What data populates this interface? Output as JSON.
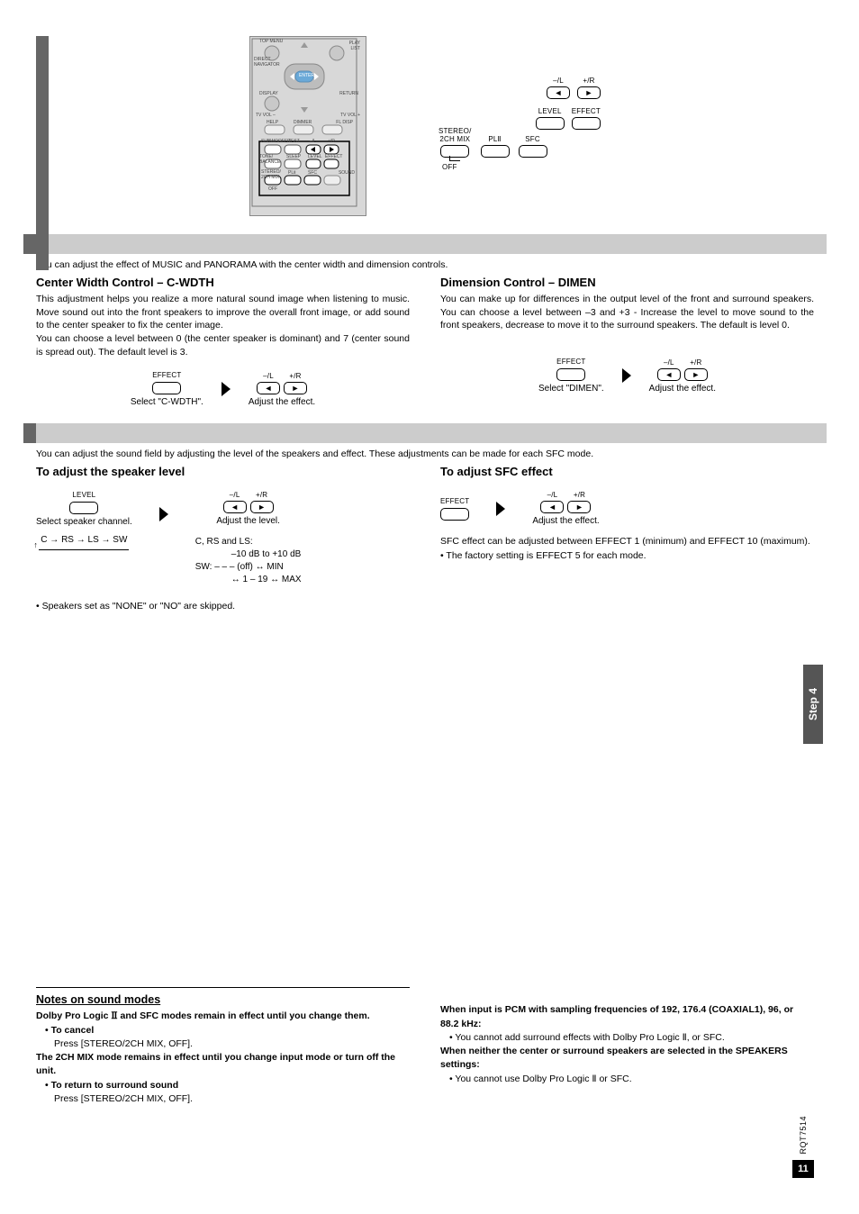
{
  "remote": {
    "labels": {
      "top_menu": "TOP MENU",
      "direct_navigator": "DIRECT NAVIGATOR",
      "play_list": "PLAY LIST",
      "enter": "ENTER",
      "display": "DISPLAY",
      "return": "RETURN",
      "tv_vol_minus": "TV VOL –",
      "tv_vol_plus": "TV VOL +",
      "help": "HELP",
      "dimmer": "DIMMER",
      "fl_disp": "FL DISP",
      "sleep2": "SLEEP",
      "subwoofer": "SUBWOOFER",
      "test": "TEST",
      "tone_balance": "TONE/ BALANCE",
      "sleep": "SLEEP",
      "minus_l": "–/L",
      "plus_r": "+/R",
      "level": "LEVEL",
      "effect": "EFFECT",
      "stereo_2ch": "STEREO/ 2CH MIX",
      "dpl2": "PLⅡ",
      "sfc": "SFC",
      "sound": "SOUND",
      "off": "OFF"
    }
  },
  "right_cluster": {
    "minus_l": "–/L",
    "plus_r": "+/R",
    "level": "LEVEL",
    "effect": "EFFECT",
    "stereo_2ch": "STEREO/\n2CH MIX",
    "dpl2": "PLⅡ",
    "sfc": "SFC",
    "off": "OFF"
  },
  "s1": {
    "intro": "You can adjust the effect of MUSIC and PANORAMA with the center width and dimension controls.",
    "left": {
      "title": "Center Width Control – C-WDTH",
      "p1": "This adjustment helps you realize a more natural sound image when listening to music. Move sound out into the front speakers to improve the overall front image, or add sound to the center speaker to fix the center image.",
      "p2": "You can choose a level between 0 (the center speaker is dominant) and 7 (center sound is spread out). The default level is 3.",
      "step1_top": "EFFECT",
      "step1_cap": "Select \"C-WDTH\".",
      "step2_top_l": "–/L",
      "step2_top_r": "+/R",
      "step2_cap": "Adjust the effect."
    },
    "right": {
      "title": "Dimension Control – DIMEN",
      "p1": "You can make up for differences in the output level of the front and surround speakers. You can choose a level between –3 and +3 - Increase the level to move sound to the front speakers, decrease to move it to the surround speakers. The default is level 0.",
      "step1_top": "EFFECT",
      "step1_cap": "Select \"DIMEN\".",
      "step2_top_l": "–/L",
      "step2_top_r": "+/R",
      "step2_cap": "Adjust the effect."
    }
  },
  "s2": {
    "intro": "You can adjust the sound field by adjusting the level of the speakers and effect. These adjustments can be made for each SFC mode.",
    "left": {
      "title": "To adjust the speaker level",
      "step1_top": "LEVEL",
      "step1_cap": "Select speaker channel.",
      "cycle": "C → RS → LS → SW",
      "step2_top_l": "–/L",
      "step2_top_r": "+/R",
      "step2_cap": "Adjust the level.",
      "ranges_1": "C, RS and LS:",
      "ranges_2": "–10 dB to +10 dB",
      "ranges_3": "SW: – – – (off) ↔ MIN",
      "ranges_4": "↔ 1 – 19 ↔ MAX",
      "note": "Speakers set as \"NONE\" or \"NO\" are skipped."
    },
    "right": {
      "title": "To adjust SFC effect",
      "step1_top": "EFFECT",
      "step2_top_l": "–/L",
      "step2_top_r": "+/R",
      "step2_cap": "Adjust the effect.",
      "p1": "SFC effect can be adjusted between EFFECT 1 (minimum) and EFFECT 10 (maximum).",
      "p2": "The factory setting is EFFECT 5 for each mode."
    }
  },
  "side_tab": "Step 4",
  "notes": {
    "title": "Notes on sound modes",
    "l1a": "Dolby Pro Logic ",
    "l1b": "Ⅱ",
    "l1c": "  and SFC modes remain in effect until you change them.",
    "l2": "To cancel",
    "l3": "Press [STEREO/2CH MIX, OFF].",
    "l4": "The 2CH MIX mode remains in effect until you change input mode or turn off the unit.",
    "l5": "To return to surround sound",
    "l6": "Press [STEREO/2CH MIX, OFF].",
    "r1": "When input is PCM with sampling frequencies of 192, 176.4 (COAXIAL1), 96, or 88.2 kHz:",
    "r2a": "You cannot add surround effects with Dolby Pro Logic ",
    "r2b": "Ⅱ",
    "r2c": ", or SFC.",
    "r3": "When neither the center or surround speakers are selected in the SPEAKERS settings:",
    "r4a": "You cannot use Dolby Pro Logic ",
    "r4b": "Ⅱ",
    "r4c": "  or SFC."
  },
  "footer": {
    "doc_id": "RQT7514",
    "page": "11"
  }
}
